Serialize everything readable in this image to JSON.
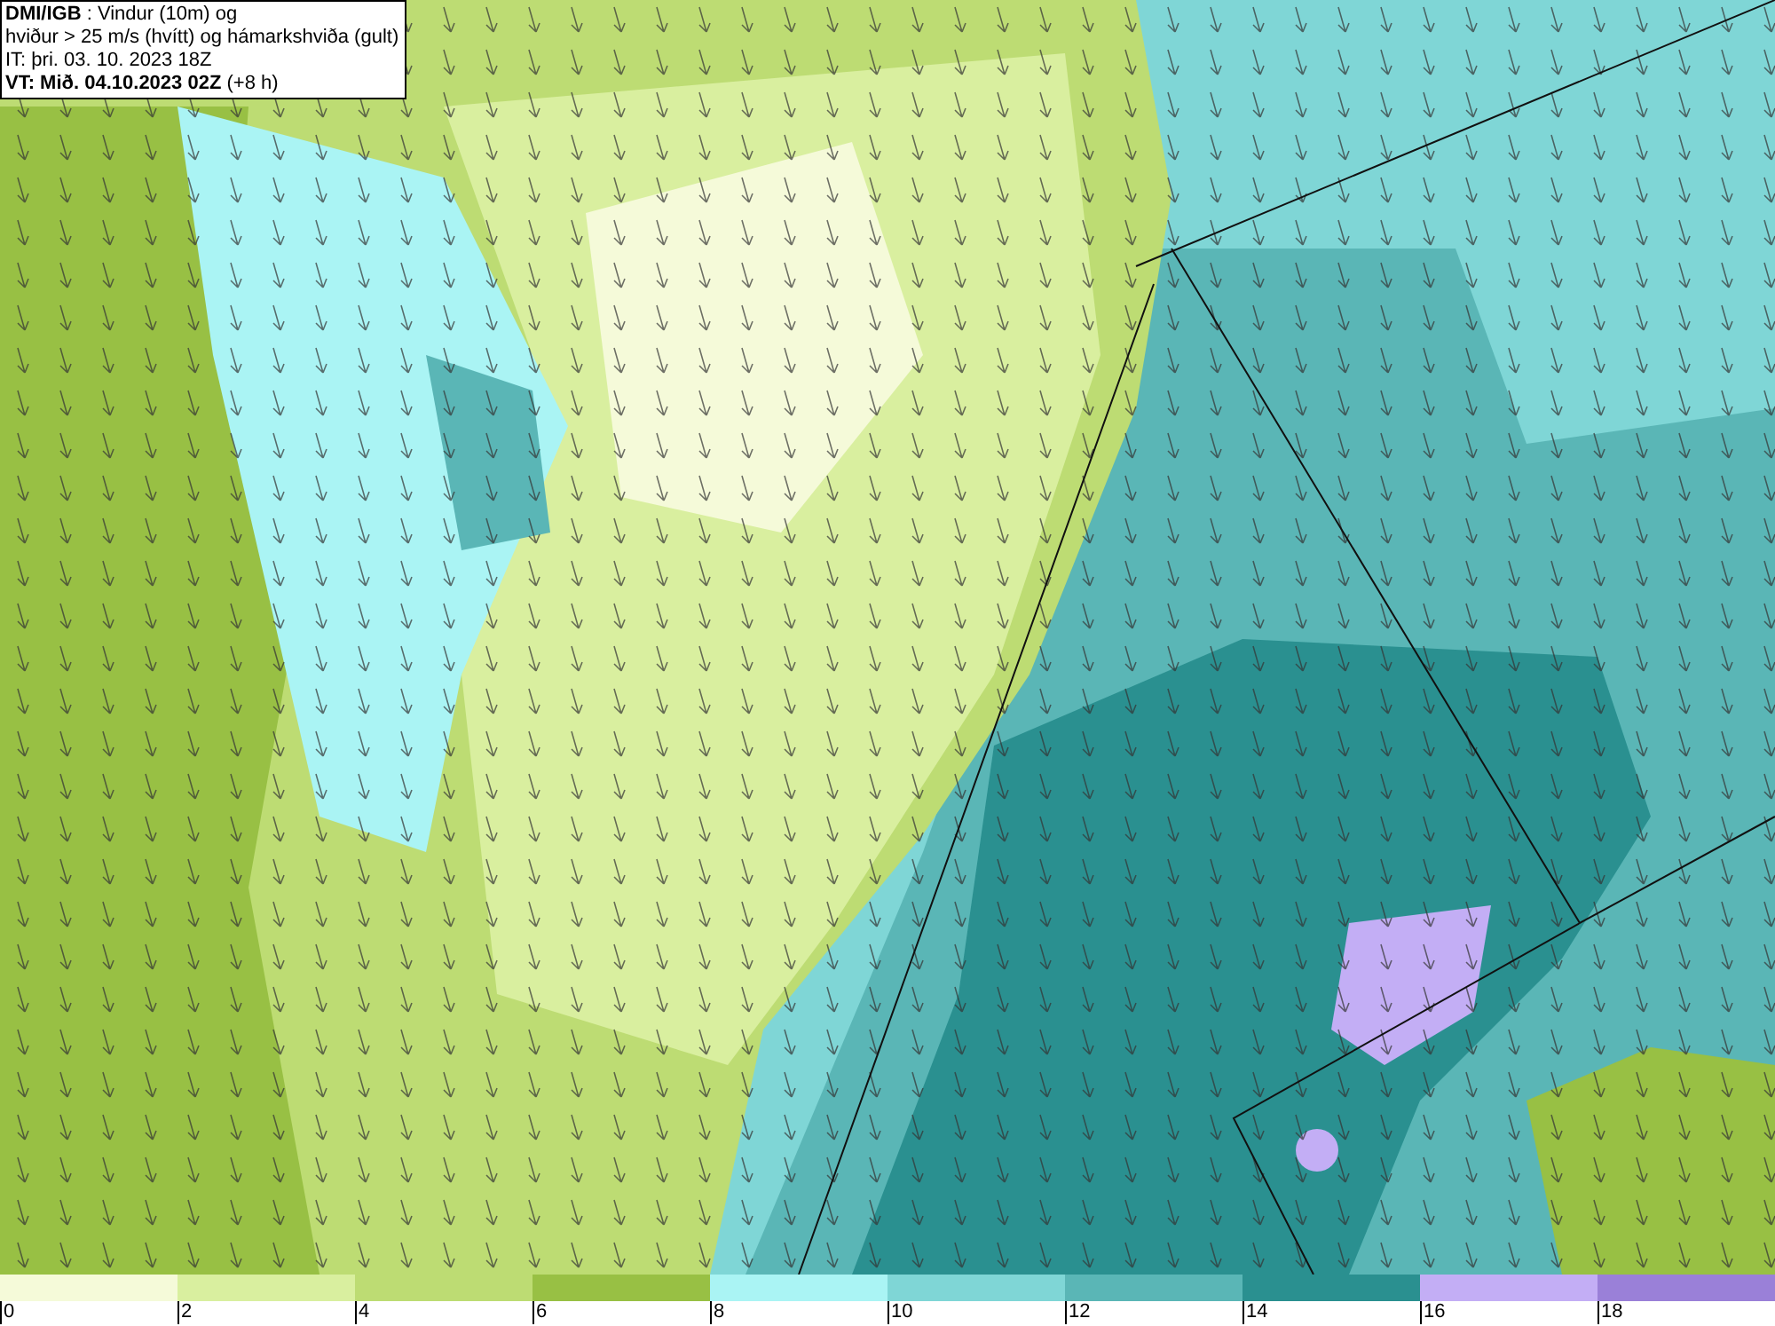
{
  "header": {
    "lines": [
      "**DMI/IGB** : Vindur (10m) og",
      "hviður > 25 m/s (hvítt) og hámarkshviða (gult)",
      "IT: þri. 03. 10. 2023 18Z",
      "**VT: Mið. 04.10.2023 02Z** (+8 h)"
    ]
  },
  "legend": [
    {
      "label": "0",
      "color": "#f5fad9"
    },
    {
      "label": "2",
      "color": "#d9ef9f"
    },
    {
      "label": "4",
      "color": "#bddc73"
    },
    {
      "label": "6",
      "color": "#98c044"
    },
    {
      "label": "8",
      "color": "#aaf4f4"
    },
    {
      "label": "10",
      "color": "#7fd6d6"
    },
    {
      "label": "12",
      "color": "#5ab6b6"
    },
    {
      "label": "14",
      "color": "#2a9090"
    },
    {
      "label": "16",
      "color": "#c3aef5"
    },
    {
      "label": "18",
      "color": "#9a80d8"
    }
  ]
}
